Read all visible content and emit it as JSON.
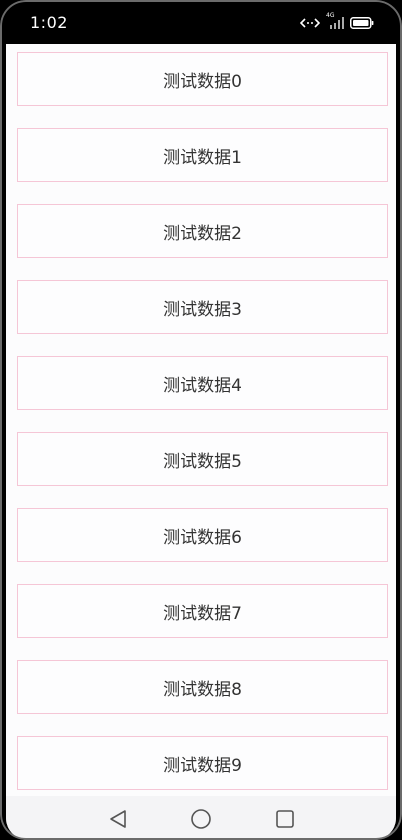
{
  "status_bar": {
    "time": "1:02",
    "network_label": "4G",
    "icons": [
      "data-transfer-icon",
      "signal-icon",
      "battery-icon"
    ]
  },
  "list": {
    "items": [
      {
        "label": "测试数据0"
      },
      {
        "label": "测试数据1"
      },
      {
        "label": "测试数据2"
      },
      {
        "label": "测试数据3"
      },
      {
        "label": "测试数据4"
      },
      {
        "label": "测试数据5"
      },
      {
        "label": "测试数据6"
      },
      {
        "label": "测试数据7"
      },
      {
        "label": "测试数据8"
      },
      {
        "label": "测试数据9"
      }
    ],
    "border_color": "#f5c6d6"
  },
  "nav_bar": {
    "icons": [
      "back-icon",
      "home-icon",
      "recents-icon"
    ]
  }
}
